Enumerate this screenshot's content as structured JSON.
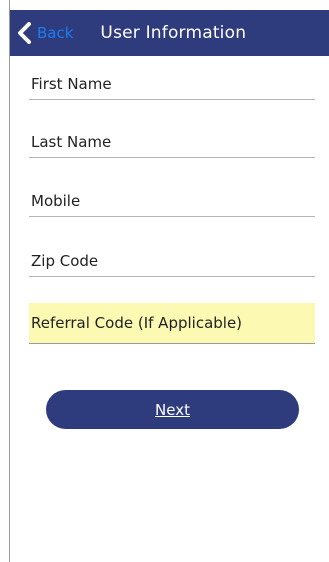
{
  "colors": {
    "nav_background": "#2e3c7e",
    "back_link": "#1d7cf2",
    "highlight_field": "#fcf9b2",
    "primary_button": "#2e3c7e"
  },
  "nav": {
    "back_icon": "chevron-left-icon",
    "back_label": "Back",
    "title": "User Information"
  },
  "form": {
    "first_name": {
      "placeholder": "First Name",
      "value": ""
    },
    "last_name": {
      "placeholder": "Last Name",
      "value": ""
    },
    "mobile": {
      "placeholder": "Mobile",
      "value": ""
    },
    "zip_code": {
      "placeholder": "Zip Code",
      "value": ""
    },
    "referral_code": {
      "placeholder": "Referral Code (If Applicable)",
      "value": ""
    }
  },
  "actions": {
    "next_label": "Next"
  }
}
